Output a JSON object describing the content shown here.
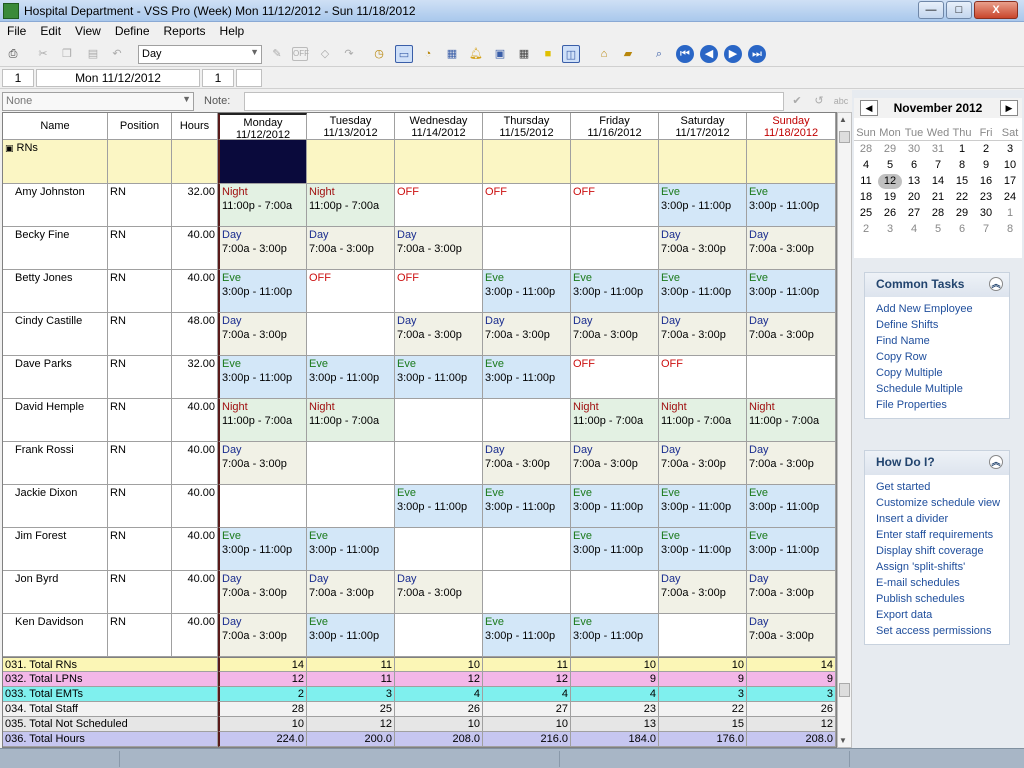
{
  "window": {
    "title": "Hospital Department - VSS Pro (Week) Mon 11/12/2012 - Sun 11/18/2012",
    "minimize": "—",
    "maximize": "□",
    "close": "X"
  },
  "menu": [
    "File",
    "Edit",
    "View",
    "Define",
    "Reports",
    "Help"
  ],
  "toolbar": {
    "shift_select": "Day"
  },
  "subbar": {
    "col1": "1",
    "date": "Mon  11/12/2012",
    "col3": "1"
  },
  "notebar": {
    "group_select": "None",
    "note_label": "Note:"
  },
  "grid": {
    "headers": {
      "name": "Name",
      "position": "Position",
      "hours": "Hours"
    },
    "days": [
      {
        "dow": "Monday",
        "date": "11/12/2012"
      },
      {
        "dow": "Tuesday",
        "date": "11/13/2012"
      },
      {
        "dow": "Wednesday",
        "date": "11/14/2012"
      },
      {
        "dow": "Thursday",
        "date": "11/15/2012"
      },
      {
        "dow": "Friday",
        "date": "11/16/2012"
      },
      {
        "dow": "Saturday",
        "date": "11/17/2012"
      },
      {
        "dow": "Sunday",
        "date": "11/18/2012"
      }
    ],
    "group_label": "RNs",
    "shift_types": {
      "D": {
        "name": "Day",
        "time": "7:00a - 3:00p",
        "cls": "t-day"
      },
      "E": {
        "name": "Eve",
        "time": "3:00p - 11:00p",
        "cls": "t-eve"
      },
      "N": {
        "name": "Night",
        "time": "11:00p - 7:00a",
        "cls": "t-night"
      },
      "O": {
        "name": "OFF",
        "time": "",
        "cls": "t-off"
      },
      "-": {
        "name": "",
        "time": "",
        "cls": "t-empty"
      }
    },
    "employees": [
      {
        "name": "Amy Johnston",
        "position": "RN",
        "hours": "32.00",
        "shifts": [
          "N",
          "N",
          "O",
          "O",
          "O",
          "E",
          "E"
        ]
      },
      {
        "name": "Becky Fine",
        "position": "RN",
        "hours": "40.00",
        "shifts": [
          "D",
          "D",
          "D",
          "-",
          "-",
          "D",
          "D"
        ]
      },
      {
        "name": "Betty Jones",
        "position": "RN",
        "hours": "40.00",
        "shifts": [
          "E",
          "O",
          "O",
          "E",
          "E",
          "E",
          "E"
        ]
      },
      {
        "name": "Cindy Castille",
        "position": "RN",
        "hours": "48.00",
        "shifts": [
          "D",
          "-",
          "D",
          "D",
          "D",
          "D",
          "D"
        ]
      },
      {
        "name": "Dave Parks",
        "position": "RN",
        "hours": "32.00",
        "shifts": [
          "E",
          "E",
          "E",
          "E",
          "O",
          "O",
          "-"
        ]
      },
      {
        "name": "David Hemple",
        "position": "RN",
        "hours": "40.00",
        "shifts": [
          "N",
          "N",
          "-",
          "-",
          "N",
          "N",
          "N"
        ]
      },
      {
        "name": "Frank Rossi",
        "position": "RN",
        "hours": "40.00",
        "shifts": [
          "D",
          "-",
          "-",
          "D",
          "D",
          "D",
          "D"
        ]
      },
      {
        "name": "Jackie Dixon",
        "position": "RN",
        "hours": "40.00",
        "shifts": [
          "-",
          "-",
          "E",
          "E",
          "E",
          "E",
          "E"
        ]
      },
      {
        "name": "Jim Forest",
        "position": "RN",
        "hours": "40.00",
        "shifts": [
          "E",
          "E",
          "-",
          "-",
          "E",
          "E",
          "E"
        ]
      },
      {
        "name": "Jon Byrd",
        "position": "RN",
        "hours": "40.00",
        "shifts": [
          "D",
          "D",
          "D",
          "-",
          "-",
          "D",
          "D"
        ]
      },
      {
        "name": "Ken Davidson",
        "position": "RN",
        "hours": "40.00",
        "shifts": [
          "D",
          "E",
          "-",
          "E",
          "E",
          "-",
          "D"
        ]
      }
    ],
    "totals": [
      {
        "label": "031. Total RNs",
        "values": [
          "14",
          "11",
          "10",
          "11",
          "10",
          "10",
          "14"
        ],
        "color": "#fbf6b6"
      },
      {
        "label": "032. Total LPNs",
        "values": [
          "12",
          "11",
          "12",
          "12",
          "9",
          "9",
          "9"
        ],
        "color": "#f3b7e8"
      },
      {
        "label": "033. Total EMTs",
        "values": [
          "2",
          "3",
          "4",
          "4",
          "4",
          "3",
          "3"
        ],
        "color": "#7ff0ee"
      },
      {
        "label": "034. Total Staff",
        "values": [
          "28",
          "25",
          "26",
          "27",
          "23",
          "22",
          "26"
        ],
        "color": "#f2f2f2"
      },
      {
        "label": "035. Total  Not Scheduled",
        "values": [
          "10",
          "12",
          "10",
          "10",
          "13",
          "15",
          "12"
        ],
        "color": "#e6e6e6"
      },
      {
        "label": "036. Total Hours",
        "values": [
          "224.0",
          "200.0",
          "208.0",
          "216.0",
          "184.0",
          "176.0",
          "208.0"
        ],
        "color": "#c6c6f0"
      }
    ]
  },
  "calendar": {
    "title": "November 2012",
    "dow": [
      "Sun",
      "Mon",
      "Tue",
      "Wed",
      "Thu",
      "Fri",
      "Sat"
    ],
    "weeks": [
      [
        [
          "28",
          1
        ],
        [
          "29",
          1
        ],
        [
          "30",
          1
        ],
        [
          "31",
          1
        ],
        [
          "1",
          0
        ],
        [
          "2",
          0
        ],
        [
          "3",
          0
        ]
      ],
      [
        [
          "4",
          0
        ],
        [
          "5",
          0
        ],
        [
          "6",
          0
        ],
        [
          "7",
          0
        ],
        [
          "8",
          0
        ],
        [
          "9",
          0
        ],
        [
          "10",
          0
        ]
      ],
      [
        [
          "11",
          0
        ],
        [
          "12",
          2
        ],
        [
          "13",
          0
        ],
        [
          "14",
          0
        ],
        [
          "15",
          0
        ],
        [
          "16",
          0
        ],
        [
          "17",
          0
        ]
      ],
      [
        [
          "18",
          0
        ],
        [
          "19",
          0
        ],
        [
          "20",
          0
        ],
        [
          "21",
          0
        ],
        [
          "22",
          0
        ],
        [
          "23",
          0
        ],
        [
          "24",
          0
        ]
      ],
      [
        [
          "25",
          0
        ],
        [
          "26",
          0
        ],
        [
          "27",
          0
        ],
        [
          "28",
          0
        ],
        [
          "29",
          0
        ],
        [
          "30",
          0
        ],
        [
          "1",
          1
        ]
      ],
      [
        [
          "2",
          1
        ],
        [
          "3",
          1
        ],
        [
          "4",
          1
        ],
        [
          "5",
          1
        ],
        [
          "6",
          1
        ],
        [
          "7",
          1
        ],
        [
          "8",
          1
        ]
      ]
    ]
  },
  "common_tasks": {
    "title": "Common Tasks",
    "items": [
      "Add New Employee",
      "Define Shifts",
      "Find Name",
      "Copy Row",
      "Copy Multiple",
      "Schedule Multiple",
      "File Properties"
    ]
  },
  "how_do_i": {
    "title": "How Do I?",
    "items": [
      "Get started",
      "Customize schedule view",
      "Insert a divider",
      "Enter staff requirements",
      "Display shift coverage",
      "Assign 'split-shifts'",
      "E-mail schedules",
      "Publish schedules",
      "Export data",
      "Set access permissions"
    ]
  },
  "icons": [
    "print-icon",
    "cut-icon",
    "copy-icon",
    "undo-icon",
    "pencil-icon",
    "off-icon",
    "eraser-icon",
    "redo-icon",
    "clock-icon",
    "week-view-icon",
    "month-icon",
    "alarm-icon",
    "card-icon",
    "grid-icon",
    "note-icon",
    "layout-icon",
    "house-icon",
    "folder-icon",
    "zoom-icon",
    "first-icon",
    "prev-icon",
    "next-icon",
    "last-icon"
  ]
}
